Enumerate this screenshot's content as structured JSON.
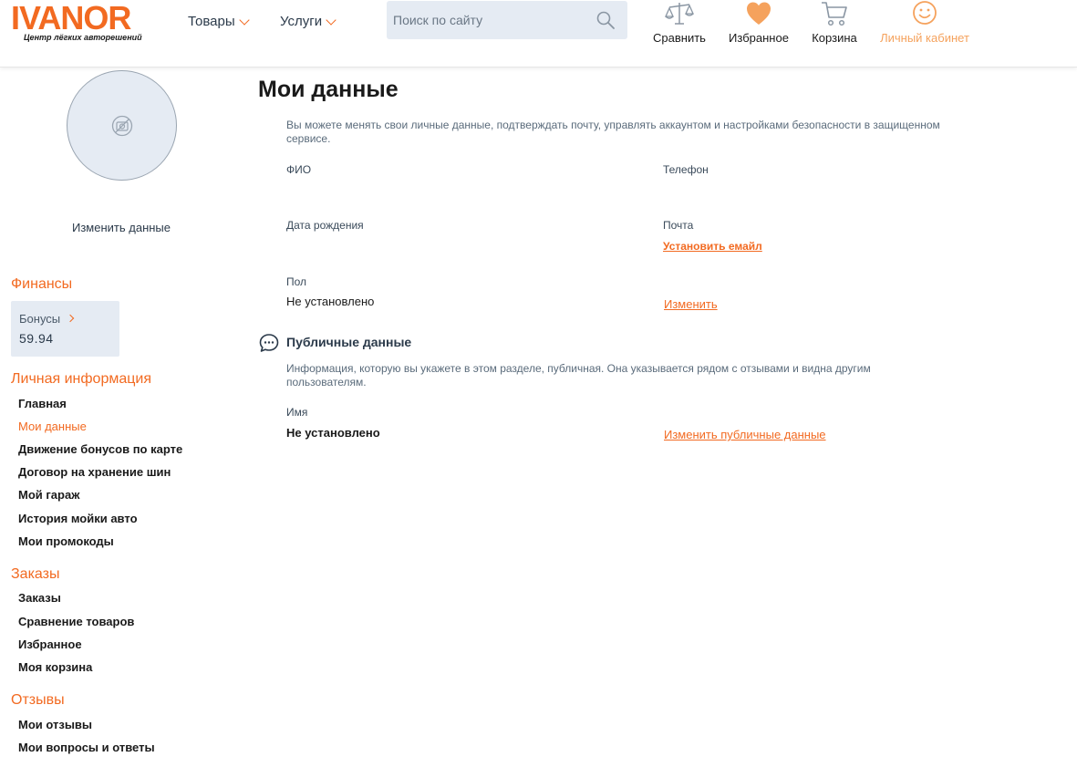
{
  "header": {
    "logo_text": "IVANOR",
    "logo_tagline": "Центр лёгких авторешений",
    "nav": [
      {
        "label": "Товары"
      },
      {
        "label": "Услуги"
      }
    ],
    "search": {
      "placeholder": "Поиск по сайту",
      "value": ""
    },
    "icons": [
      {
        "label": "Сравнить",
        "icon": "scales-icon"
      },
      {
        "label": "Избранное",
        "icon": "heart-icon"
      },
      {
        "label": "Корзина",
        "icon": "cart-icon"
      },
      {
        "label": "Личный кабинет",
        "icon": "smile-icon"
      }
    ],
    "colors": {
      "accent": "#f26a21",
      "light_accent": "#f5a25d",
      "search_bg": "#e5ebf3"
    }
  },
  "sidebar": {
    "avatar_icon": "no-photo-icon",
    "edit_label": "Изменить данные",
    "finance": {
      "title": "Финансы",
      "bonus_label": "Бонусы",
      "bonus_value": "59.94"
    },
    "personal": {
      "title": "Личная информация",
      "items": [
        {
          "label": "Главная"
        },
        {
          "label": "Мои данные"
        },
        {
          "label": "Движение бонусов по карте"
        },
        {
          "label": "Договор на хранение шин"
        },
        {
          "label": "Мой гараж"
        },
        {
          "label": "История мойки авто"
        },
        {
          "label": "Мои промокоды"
        }
      ]
    },
    "orders": {
      "title": "Заказы",
      "items": [
        {
          "label": "Заказы"
        },
        {
          "label": "Сравнение товаров"
        },
        {
          "label": "Избранное"
        },
        {
          "label": "Моя корзина"
        }
      ]
    },
    "reviews": {
      "title": "Отзывы",
      "items": [
        {
          "label": "Мои отзывы"
        },
        {
          "label": "Мои вопросы и ответы"
        }
      ]
    }
  },
  "main": {
    "title": "Мои данные",
    "description": "Вы можете менять свои личные данные, подтверждать почту, управлять аккаунтом и настройками безопасности в защищенном сервисе.",
    "fields": {
      "fio_label": "ФИО",
      "phone_label": "Телефон",
      "birth_label": "Дата рождения",
      "email_label": "Почта",
      "email_link": "Установить емайл",
      "gender_label": "Пол",
      "gender_value": "Не установлено",
      "edit_link": "Изменить"
    },
    "public": {
      "title": "Публичные данные",
      "icon": "chat-icon",
      "description": "Информация, которую вы укажете в этом разделе, публичная. Она указывается рядом с отзывами и видна другим пользователям.",
      "name_label": "Имя",
      "name_value": "Не установлено",
      "edit_link": "Изменить публичные данные"
    }
  }
}
